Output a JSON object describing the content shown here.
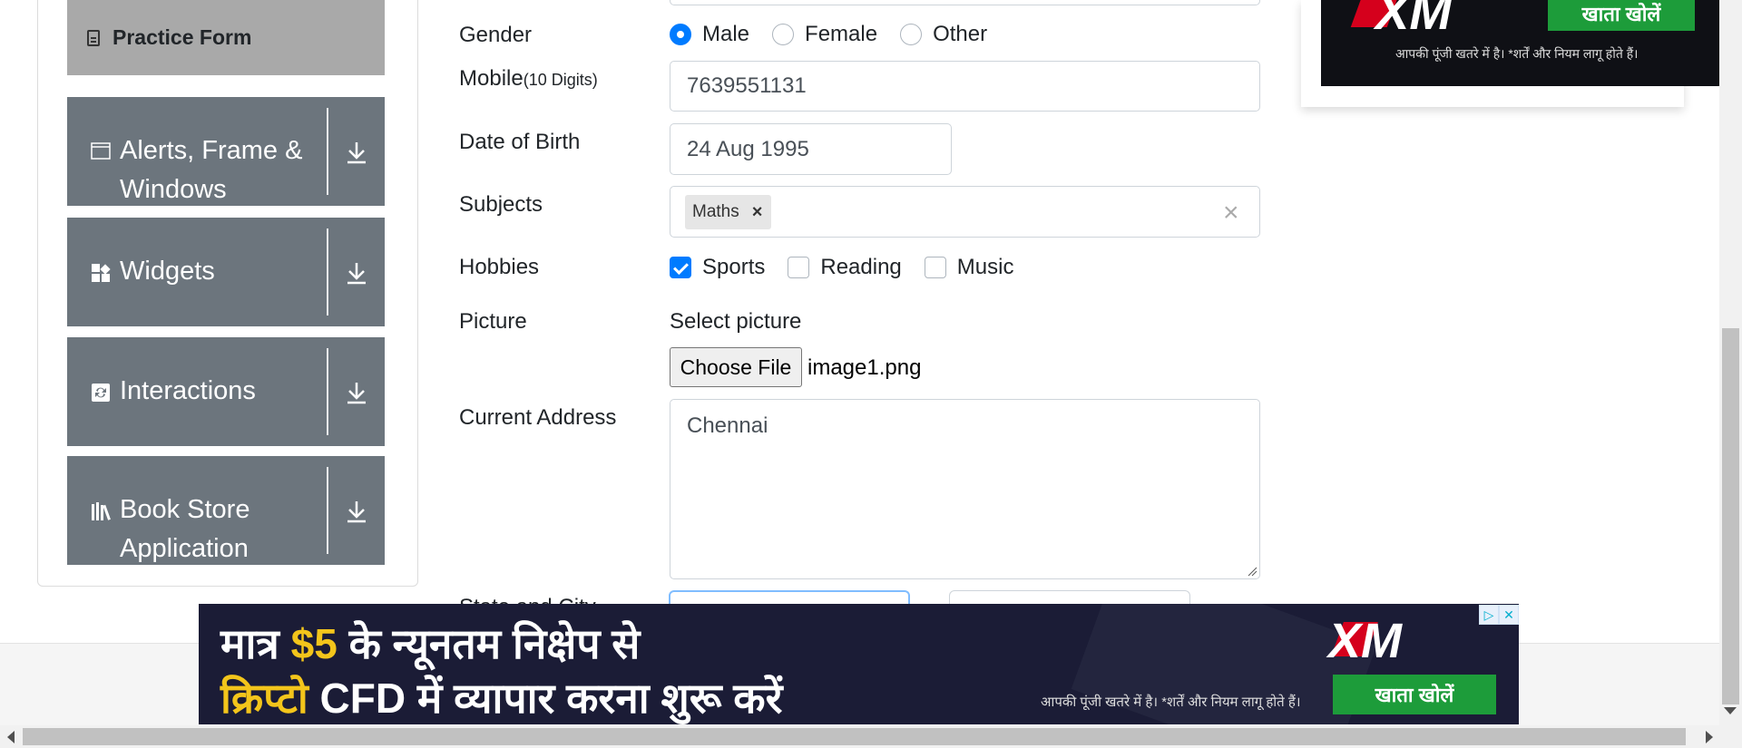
{
  "sidebar": {
    "practice_form": "Practice Form",
    "groups": [
      {
        "label": "Alerts, Frame & Windows",
        "icon": "window-icon"
      },
      {
        "label": "Widgets",
        "icon": "widgets-icon"
      },
      {
        "label": "Interactions",
        "icon": "interactions-icon"
      },
      {
        "label": "Book Store Application",
        "icon": "books-icon"
      }
    ]
  },
  "form": {
    "gender_label": "Gender",
    "gender_options": [
      "Male",
      "Female",
      "Other"
    ],
    "gender_selected": "Male",
    "mobile_label": "Mobile",
    "mobile_hint": "(10 Digits)",
    "mobile_value": "7639551131",
    "dob_label": "Date of Birth",
    "dob_value": "24 Aug 1995",
    "subjects_label": "Subjects",
    "subjects": [
      "Maths"
    ],
    "hobbies_label": "Hobbies",
    "hobbies": [
      {
        "label": "Sports",
        "checked": true
      },
      {
        "label": "Reading",
        "checked": false
      },
      {
        "label": "Music",
        "checked": false
      }
    ],
    "picture_label": "Picture",
    "picture_prompt": "Select picture",
    "choose_file": "Choose File",
    "file_name": "image1.png",
    "address_label": "Current Address",
    "address_value": "Chennai",
    "state_city_label": "State and City"
  },
  "ads": {
    "top": {
      "brand": "XM",
      "button": "खाता खोलें",
      "fine_print": "आपकी पूंजी खतरे में है। *शर्तें और नियम लागू होते हैं।"
    },
    "banner": {
      "line1_prefix": "मात्र",
      "line1_amount": "$5",
      "line1_rest": "के न्यूनतम निक्षेप से",
      "line2_highlight": "क्रिप्टो",
      "line2_rest": "CFD में  व्यापार करना शुरू करें",
      "brand": "XM",
      "fine_print": "आपकी पूंजी खतरे में है। *शर्तें और नियम लागू होते हैं।",
      "button": "खाता खोलें"
    }
  }
}
